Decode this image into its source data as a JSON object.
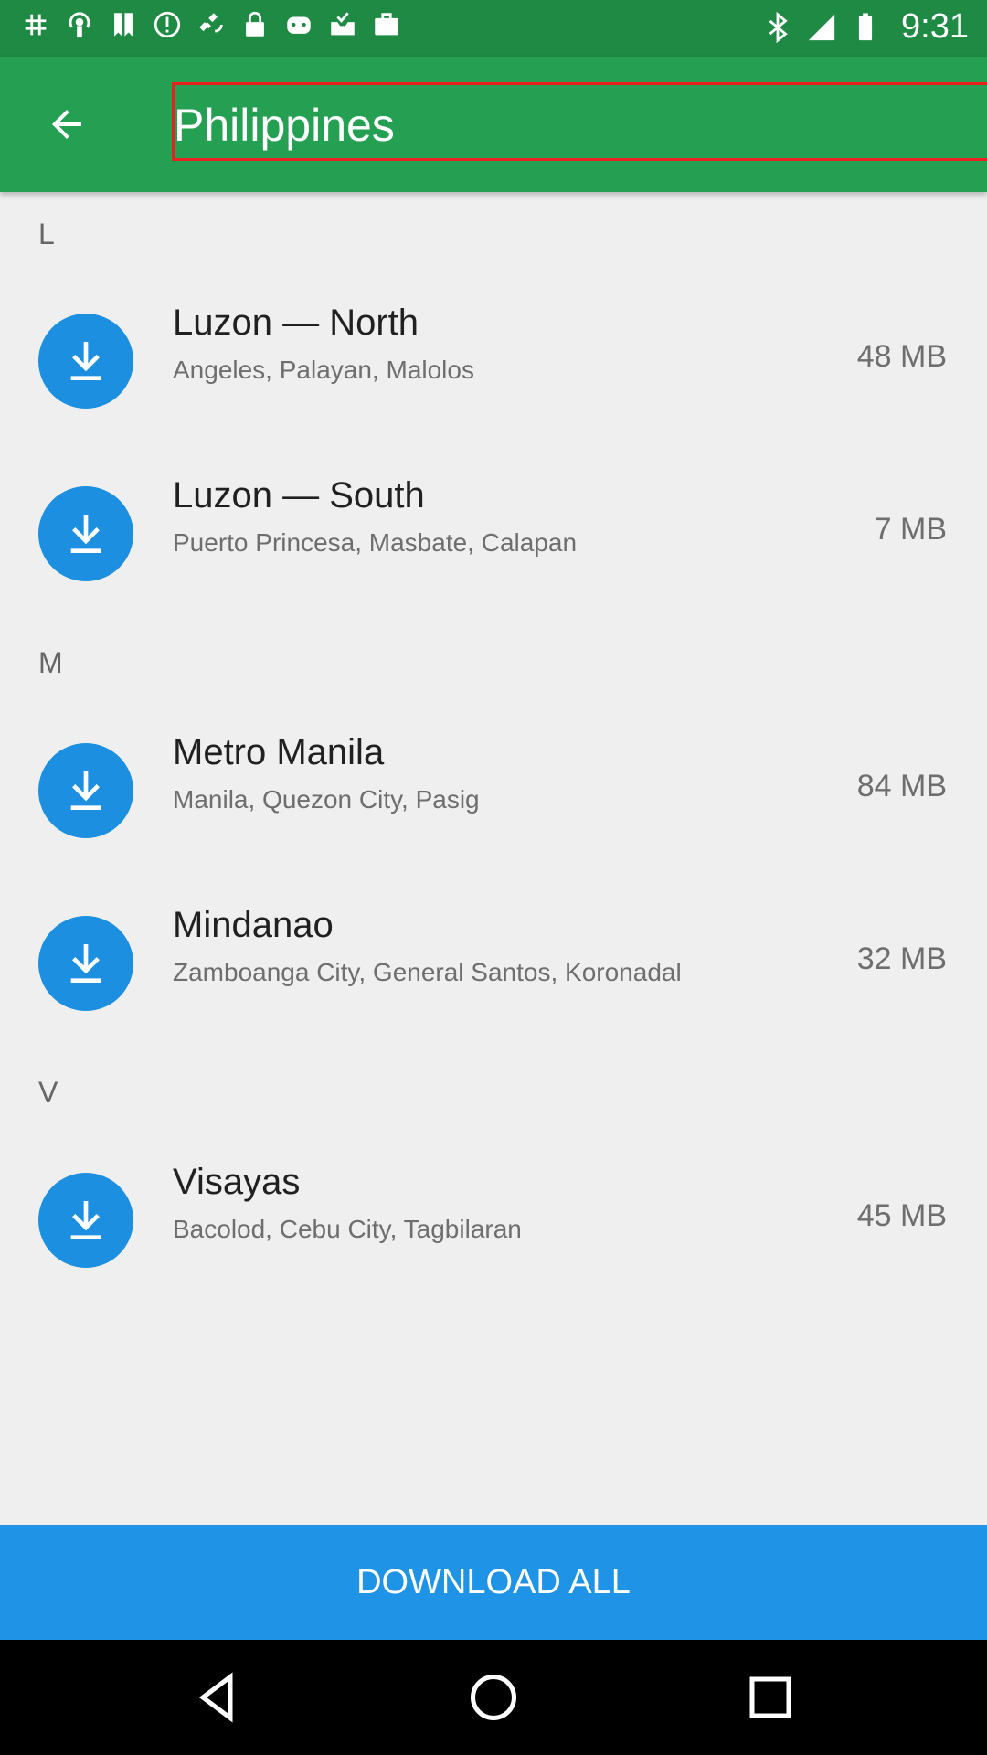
{
  "status_bar": {
    "time": "9:31",
    "left_icons": [
      "hashtag-icon",
      "podcast-icon",
      "bookmark-icon",
      "alert-icon",
      "satellite-icon",
      "lock-icon",
      "gamepad-icon",
      "inbox-icon",
      "briefcase-icon"
    ],
    "right_icons": [
      "bluetooth-icon",
      "signal-icon",
      "battery-icon"
    ]
  },
  "app_bar": {
    "title": "Philippines",
    "back_icon": "back-arrow-icon"
  },
  "sections": [
    {
      "letter": "L",
      "items": [
        {
          "title": "Luzon — North",
          "subtitle": "Angeles, Palayan, Malolos",
          "size": "48 MB"
        },
        {
          "title": "Luzon — South",
          "subtitle": "Puerto Princesa, Masbate, Calapan",
          "size": "7 MB"
        }
      ]
    },
    {
      "letter": "M",
      "items": [
        {
          "title": "Metro Manila",
          "subtitle": "Manila, Quezon City, Pasig",
          "size": "84 MB"
        },
        {
          "title": "Mindanao",
          "subtitle": "Zamboanga City, General Santos, Koronadal",
          "size": "32 MB"
        }
      ]
    },
    {
      "letter": "V",
      "items": [
        {
          "title": "Visayas",
          "subtitle": "Bacolod, Cebu City, Tagbilaran",
          "size": "45 MB"
        }
      ]
    }
  ],
  "download_all_label": "DOWNLOAD ALL",
  "colors": {
    "status_bar": "#1e8a44",
    "app_bar": "#25a052",
    "accent_blue": "#1c8fe0",
    "highlight_border": "#e8201e"
  }
}
